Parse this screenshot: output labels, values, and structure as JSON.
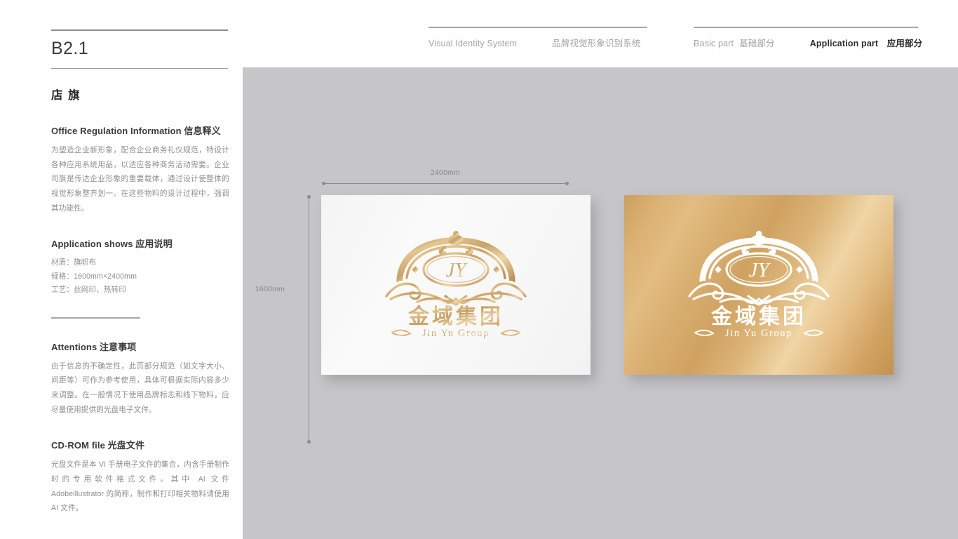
{
  "header": {
    "nav_left": {
      "en": "Visual Identity System",
      "cn": "品牌视觉形象识别系统"
    },
    "nav_right": {
      "basic_en": "Basic part",
      "basic_cn": "基础部分",
      "application_en": "Application part",
      "application_cn": "应用部分"
    }
  },
  "sidebar": {
    "page_code": "B2.1",
    "section_title": "店 旗",
    "blocks": [
      {
        "head_en": "Office Regulation Information",
        "head_cn": "信息释义",
        "body": "为塑造企业新形象，配合企业商务礼仪规范，特设计各种应用系统用品，以适应各种商务活动需要。企业司旗是传达企业形象的重要载体，通过设计使整体的视觉形象整齐划一。在这些物料的设计过程中，强调其功能性。"
      },
      {
        "head_en": "Application shows",
        "head_cn": "应用说明",
        "specs": [
          "材质：旗帜布",
          "规格：1600mm×2400mm",
          "工艺：丝网印、热转印"
        ]
      },
      {
        "head_en": "Attentions",
        "head_cn": "注意事项",
        "body": "由于信息的不确定性，此页部分规范（如文字大小、间距等）可作为参考使用，具体可根据实际内容多少来调整。在一般情况下使用品牌标志和线下物料，应尽量使用提供的光盘电子文件。"
      },
      {
        "head_en": "CD-ROM file",
        "head_cn": "光盘文件",
        "body": "光盘文件是本 VI 手册电子文件的集合，内含手册制作时的专用软件格式文件。其中 AI 文件 Adobeillustrator 的简称，制作和打印相关物料请使用 AI 文件。"
      }
    ]
  },
  "stage": {
    "dimension_width": "2400mm",
    "dimension_height": "1600mm",
    "flags": [
      {
        "variant": "white-flag",
        "logo_color": "#c8a063"
      },
      {
        "variant": "gold-flag",
        "logo_color": "#ffffff"
      }
    ]
  },
  "logo": {
    "monogram": "JY",
    "name_cn": "金域集团",
    "name_en": "Jin Yu Group"
  },
  "colors": {
    "stage_bg": "#c6c6c8",
    "gold_light": "#f0d5a6",
    "gold_mid": "#d8ae6f",
    "gold_dark": "#c2924f",
    "logo_gold": "#c8a063",
    "text_dark": "#2e2e2e",
    "text_muted": "#a3a3a3"
  }
}
